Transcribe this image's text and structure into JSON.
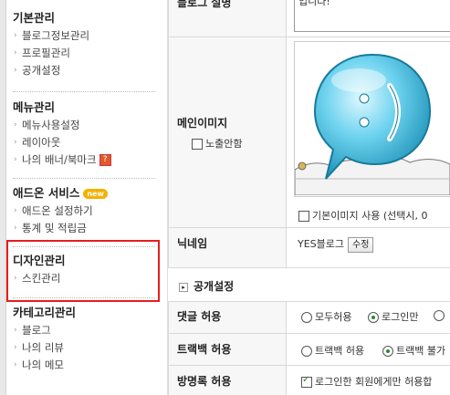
{
  "sidebar": {
    "sections": [
      {
        "title": "기본관리",
        "items": [
          "블로그정보관리",
          "프로필관리",
          "공개설정"
        ]
      },
      {
        "title": "메뉴관리",
        "items": [
          "메뉴사용설정",
          "레이아웃",
          "나의 배너/북마크"
        ]
      },
      {
        "title": "애드온 서비스",
        "badge": "new",
        "items": [
          "애드온 설정하기",
          "통계 및 적립금"
        ]
      },
      {
        "title": "디자인관리",
        "items": [
          "스킨관리"
        ]
      },
      {
        "title": "카테고리관리",
        "items": [
          "블로그",
          "나의 리뷰",
          "나의 메모"
        ]
      }
    ],
    "help_mark": "?"
  },
  "main": {
    "blog_intro_label": "블로그 설명",
    "blog_intro_value": "입니다!",
    "main_image_label": "메인이미지",
    "hide_image_label": "노출안함",
    "default_image_label": "기본이미지 사용 (선택시, 0",
    "nickname_label": "닉네임",
    "nickname_value": "YES블로그",
    "edit_button": "수정",
    "public_settings_title": "공개설정",
    "comments_label": "댓글 허용",
    "comments_options": [
      "모두허용",
      "로그인만",
      ""
    ],
    "trackback_label": "트랙백 허용",
    "trackback_options": [
      "트랙백 허용",
      "트랙백 불가"
    ],
    "guestbook_label": "방명록 허용",
    "guestbook_option": "로그인한 회원에게만 허용합"
  }
}
